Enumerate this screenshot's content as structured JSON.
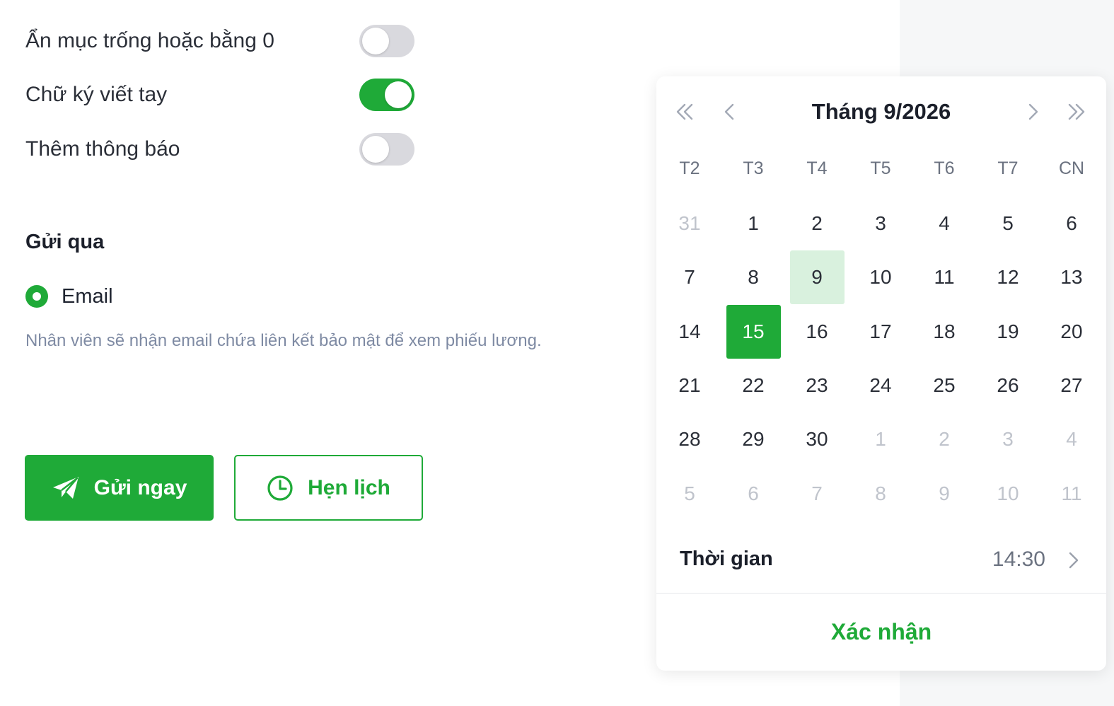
{
  "settings": [
    {
      "label": "Ẩn mục trống hoặc bằng 0",
      "on": false
    },
    {
      "label": "Chữ ký viết tay",
      "on": true
    },
    {
      "label": "Thêm thông báo",
      "on": false
    }
  ],
  "send_via": {
    "title": "Gửi qua",
    "option_label": "Email",
    "hint": "Nhân viên sẽ nhận email chứa liên kết bảo mật để xem phiếu lương."
  },
  "actions": {
    "send_now": "Gửi ngay",
    "schedule": "Hẹn lịch"
  },
  "colors": {
    "accent": "#1faa38",
    "accent_light": "#d9f1de"
  },
  "calendar": {
    "title": "Tháng 9/2026",
    "weekdays": [
      "T2",
      "T3",
      "T4",
      "T5",
      "T6",
      "T7",
      "CN"
    ],
    "weeks": [
      [
        "31",
        "1",
        "2",
        "3",
        "4",
        "5",
        "6"
      ],
      [
        "7",
        "8",
        "9",
        "10",
        "11",
        "12",
        "13"
      ],
      [
        "14",
        "15",
        "16",
        "17",
        "18",
        "19",
        "20"
      ],
      [
        "21",
        "22",
        "23",
        "24",
        "25",
        "26",
        "27"
      ],
      [
        "28",
        "29",
        "30",
        "1",
        "2",
        "3",
        "4"
      ],
      [
        "5",
        "6",
        "7",
        "8",
        "9",
        "10",
        "11"
      ]
    ],
    "today": "9",
    "selected": "15",
    "time_label": "Thời gian",
    "time_value": "14:30",
    "confirm_label": "Xác nhận"
  }
}
